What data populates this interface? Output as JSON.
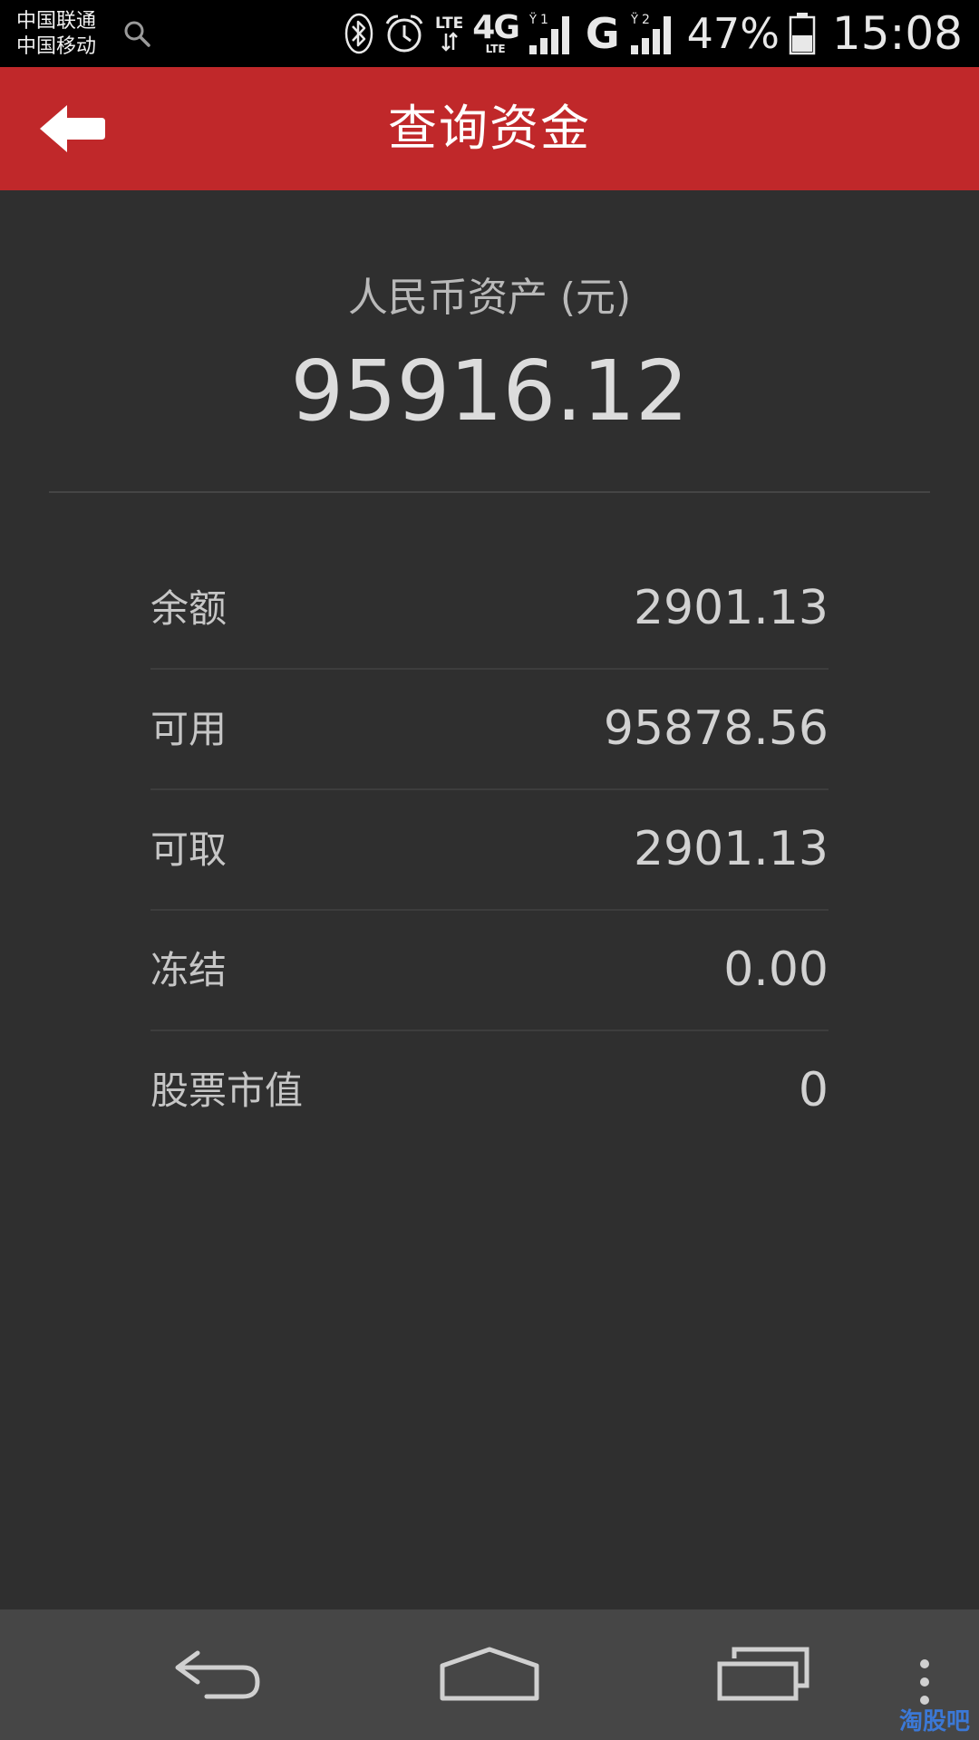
{
  "status_bar": {
    "carrier_1": "中国联通",
    "carrier_2": "中国移动",
    "lte_label": "LTE",
    "net_4g": "4G",
    "net_4g_sub": "LTE",
    "sim1_label": "1",
    "net_g": "G",
    "sim2_label": "2",
    "battery_percent": "47%",
    "battery_level": 0.47,
    "time": "15:08"
  },
  "header": {
    "title": "查询资金",
    "background": "#c0282a"
  },
  "summary": {
    "label": "人民币资产 (元)",
    "value": "95916.12"
  },
  "rows": [
    {
      "label": "余额",
      "value": "2901.13"
    },
    {
      "label": "可用",
      "value": "95878.56"
    },
    {
      "label": "可取",
      "value": "2901.13"
    },
    {
      "label": "冻结",
      "value": "0.00"
    },
    {
      "label": "股票市值",
      "value": "0"
    }
  ],
  "navigation": {
    "icons": [
      "back-icon",
      "home-icon",
      "recent-apps-icon",
      "menu-icon"
    ]
  },
  "watermark": "淘股吧"
}
